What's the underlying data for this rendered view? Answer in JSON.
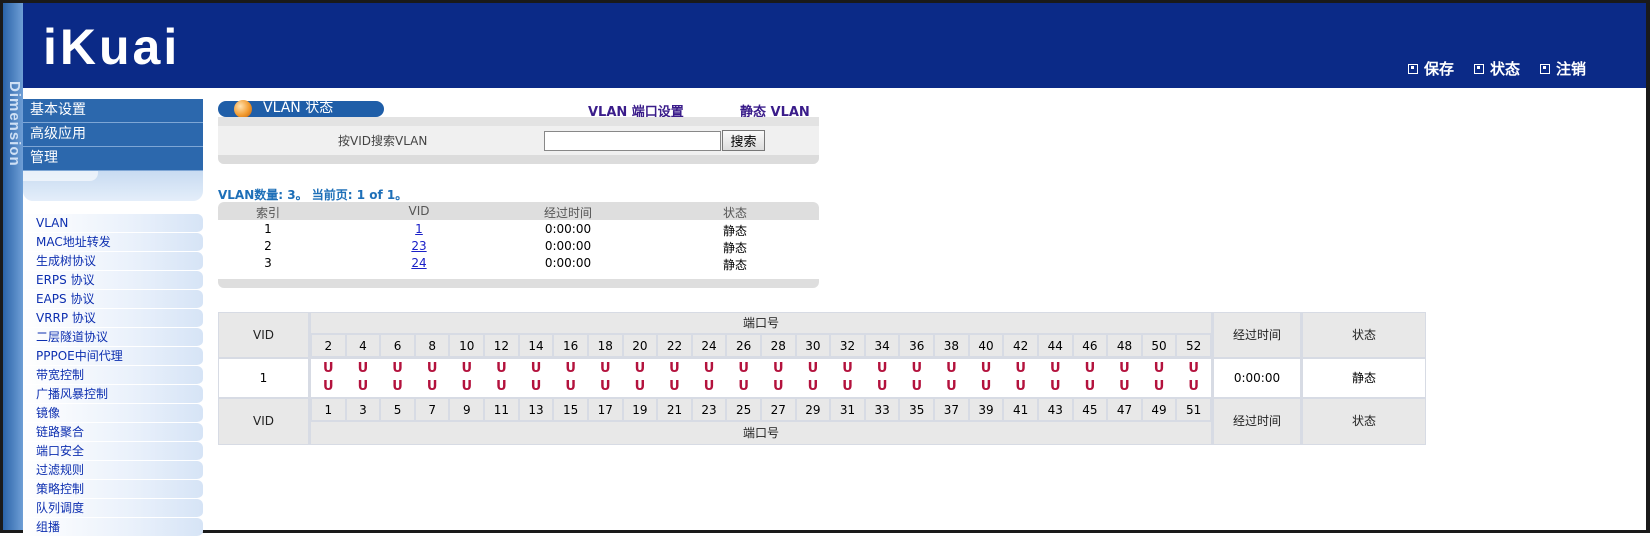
{
  "brand": {
    "logo": "iKuai",
    "side_text": "Dimension"
  },
  "header": {
    "actions": [
      {
        "label": "保存",
        "icon": "save-icon"
      },
      {
        "label": "状态",
        "icon": "status-icon"
      },
      {
        "label": "注销",
        "icon": "logout-icon"
      }
    ]
  },
  "sidebar": {
    "main": [
      "基本设置",
      "高级应用",
      "管理"
    ],
    "sub": [
      "VLAN",
      "MAC地址转发",
      "生成树协议",
      "ERPS 协议",
      "EAPS 协议",
      "VRRP 协议",
      "二层隧道协议",
      "PPPOE中间代理",
      "带宽控制",
      "广播风暴控制",
      "镜像",
      "链路聚合",
      "端口安全",
      "过滤规则",
      "策略控制",
      "队列调度",
      "组播"
    ]
  },
  "tabs": {
    "current": "VLAN 状态",
    "port_settings": "VLAN 端口设置",
    "static_vlan": "静态 VLAN"
  },
  "search": {
    "label": "按VID搜索VLAN",
    "value": "",
    "button": "搜索"
  },
  "summary": "VLAN数量: 3。 当前页: 1 of 1。",
  "vlan_list": {
    "headers": [
      "索引",
      "VID",
      "经过时间",
      "状态"
    ],
    "rows": [
      {
        "index": "1",
        "vid": "1",
        "time": "0:00:00",
        "status": "静态"
      },
      {
        "index": "2",
        "vid": "23",
        "time": "0:00:00",
        "status": "静态"
      },
      {
        "index": "3",
        "vid": "24",
        "time": "0:00:00",
        "status": "静态"
      }
    ]
  },
  "port_table": {
    "vid_label": "VID",
    "port_label": "端口号",
    "time_label": "经过时间",
    "status_label": "状态",
    "even_ports": [
      "2",
      "4",
      "6",
      "8",
      "10",
      "12",
      "14",
      "16",
      "18",
      "20",
      "22",
      "24",
      "26",
      "28",
      "30",
      "32",
      "34",
      "36",
      "38",
      "40",
      "42",
      "44",
      "46",
      "48",
      "50",
      "52"
    ],
    "odd_ports": [
      "1",
      "3",
      "5",
      "7",
      "9",
      "11",
      "13",
      "15",
      "17",
      "19",
      "21",
      "23",
      "25",
      "27",
      "29",
      "31",
      "33",
      "35",
      "37",
      "39",
      "41",
      "43",
      "45",
      "47",
      "49",
      "51"
    ],
    "row": {
      "vid": "1",
      "mark": "U",
      "time": "0:00:00",
      "status": "静态"
    }
  }
}
